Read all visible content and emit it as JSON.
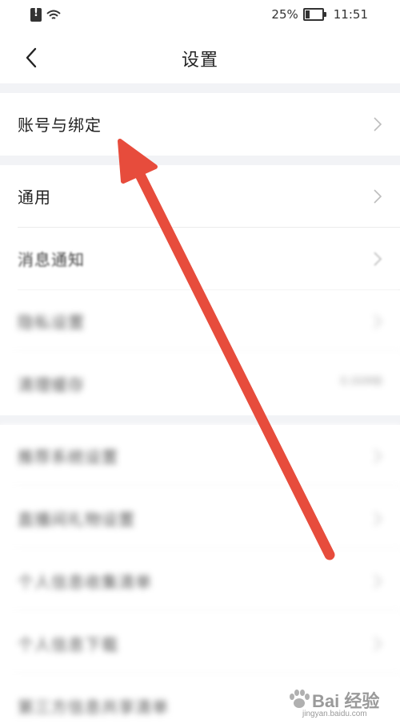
{
  "status_bar": {
    "battery_percent": "25%",
    "time": "11:51",
    "icons": [
      "sim-alert-icon",
      "wifi-icon",
      "battery-icon"
    ]
  },
  "header": {
    "title": "设置",
    "back_icon": "back-chevron-icon"
  },
  "sections": [
    {
      "items": [
        {
          "label": "账号与绑定",
          "icon": "chevron-right-icon"
        }
      ]
    },
    {
      "items": [
        {
          "label": "通用",
          "icon": "chevron-right-icon"
        },
        {
          "label": "消息通知",
          "icon": "chevron-right-icon"
        },
        {
          "label": "隐私设置",
          "icon": "chevron-right-icon",
          "blurred": true
        },
        {
          "label": "清理缓存",
          "value": "0.00MB",
          "blurred": true
        }
      ]
    },
    {
      "items": [
        {
          "label": "推荐系统设置",
          "blurred": true
        },
        {
          "label": "直播间礼物设置",
          "blurred": true
        },
        {
          "label": "个人信息收集清单",
          "blurred": true
        },
        {
          "label": "个人信息下载",
          "blurred": true
        },
        {
          "label": "第三方信息共享清单",
          "blurred": true
        }
      ]
    }
  ],
  "annotation": {
    "type": "arrow",
    "color": "#e74c3c",
    "points_to": "账号与绑定"
  },
  "watermark": {
    "main": "Bai 经验",
    "sub": "jingyan.baidu.com"
  },
  "colors": {
    "background": "#ffffff",
    "section_gap": "#f2f3f6",
    "arrow": "#e74c3c"
  }
}
